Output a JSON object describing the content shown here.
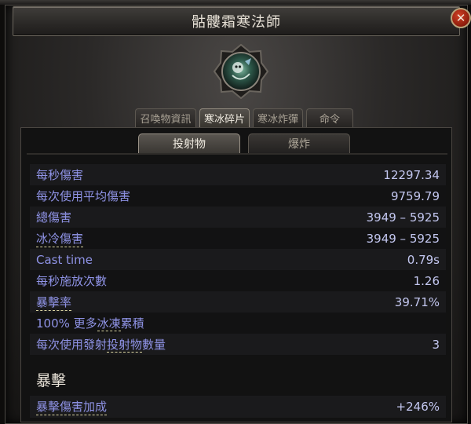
{
  "window": {
    "title": "骷髏霜寒法師"
  },
  "tabs": [
    {
      "label": "召喚物資訊",
      "active": false
    },
    {
      "label": "寒冰碎片",
      "active": true
    },
    {
      "label": "寒冰炸彈",
      "active": false
    },
    {
      "label": "命令",
      "active": false
    }
  ],
  "sub_tabs": [
    {
      "label": "投射物",
      "active": true
    },
    {
      "label": "爆炸",
      "active": false
    }
  ],
  "stats": [
    {
      "label": "每秒傷害",
      "value": "12297.34"
    },
    {
      "label": "每次使用平均傷害",
      "value": "9759.79"
    },
    {
      "label": "總傷害",
      "value": "3949 – 5925"
    },
    {
      "label": "冰冷傷害",
      "value": "3949 – 5925"
    },
    {
      "label": "Cast time",
      "value": "0.79s"
    },
    {
      "label": "每秒施放次數",
      "value": "1.26"
    },
    {
      "label": "暴擊率",
      "value": "39.71%"
    },
    {
      "label": "100% 更多冰凍累積",
      "value": ""
    },
    {
      "label": "每次使用發射投射物數量",
      "value": "3"
    }
  ],
  "critical_section": {
    "heading": "暴擊",
    "label": "暴擊傷害加成",
    "value": "+246%"
  },
  "icons": {
    "close": "close-icon",
    "emblem": "skeleton-frost-mage-emblem-icon"
  },
  "colors": {
    "stat_label": "#8f93e6",
    "stat_value": "#c3c7f0",
    "close_button": "#b52a14"
  }
}
